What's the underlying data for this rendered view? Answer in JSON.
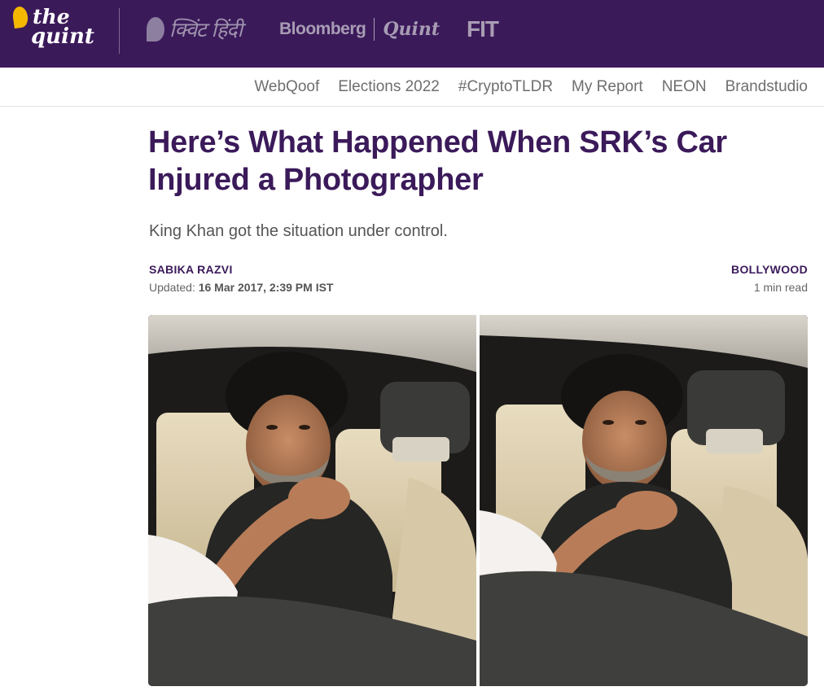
{
  "brand": {
    "logo_the": "the",
    "logo_quint": "quint",
    "hindi": "क्विंट हिंदी",
    "bloomberg": "Bloomberg",
    "bloomberg_quint": "Quint",
    "fit": "FIT",
    "bar_color": "#3b1a5a",
    "logo_color": "#f5b800"
  },
  "nav": {
    "items": [
      "WebQoof",
      "Elections 2022",
      "#CryptoTLDR",
      "My Report",
      "NEON",
      "Brandstudio"
    ]
  },
  "article": {
    "headline": "Here’s What Happened When SRK’s Car Injured a Photographer",
    "subhead": "King Khan got the situation under control.",
    "author": "SABIKA RAZVI",
    "updated_label": "Updated:",
    "updated_date": "16 Mar 2017, 2:39 PM IST",
    "category": "BOLLYWOOD",
    "read_time": "1 min read"
  }
}
